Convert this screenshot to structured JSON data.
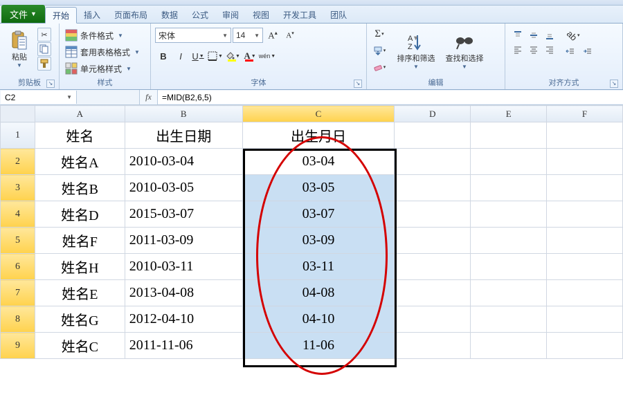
{
  "tabs": {
    "file": "文件",
    "home": "开始",
    "insert": "插入",
    "layout": "页面布局",
    "data": "数据",
    "formulas": "公式",
    "review": "审阅",
    "view": "视图",
    "developer": "开发工具",
    "team": "团队"
  },
  "ribbon": {
    "clipboard": {
      "label": "剪贴板",
      "paste": "粘贴"
    },
    "styles": {
      "label": "样式",
      "conditional": "条件格式",
      "tableFormat": "套用表格格式",
      "cellStyles": "单元格样式"
    },
    "font": {
      "label": "字体",
      "name": "宋体",
      "size": "14",
      "bold": "B",
      "italic": "I",
      "underline": "U",
      "wen": "wén"
    },
    "editing": {
      "label": "编辑",
      "sortFilter": "排序和筛选",
      "findSelect": "查找和选择"
    },
    "alignment": {
      "label": "对齐方式"
    }
  },
  "nameBox": "C2",
  "fxLabel": "fx",
  "formula": "=MID(B2,6,5)",
  "columns": [
    "A",
    "B",
    "C",
    "D",
    "E",
    "F"
  ],
  "headers": {
    "A": "姓名",
    "B": "出生日期",
    "C": "出生月日"
  },
  "rows": [
    {
      "n": "2",
      "A": "姓名A",
      "B": "2010-03-04",
      "C": "03-04"
    },
    {
      "n": "3",
      "A": "姓名B",
      "B": "2010-03-05",
      "C": "03-05"
    },
    {
      "n": "4",
      "A": "姓名D",
      "B": "2015-03-07",
      "C": "03-07"
    },
    {
      "n": "5",
      "A": "姓名F",
      "B": "2011-03-09",
      "C": "03-09"
    },
    {
      "n": "6",
      "A": "姓名H",
      "B": "2010-03-11",
      "C": "03-11"
    },
    {
      "n": "7",
      "A": "姓名E",
      "B": "2013-04-08",
      "C": "04-08"
    },
    {
      "n": "8",
      "A": "姓名G",
      "B": "2012-04-10",
      "C": "04-10"
    },
    {
      "n": "9",
      "A": "姓名C",
      "B": "2011-11-06",
      "C": "11-06"
    }
  ]
}
